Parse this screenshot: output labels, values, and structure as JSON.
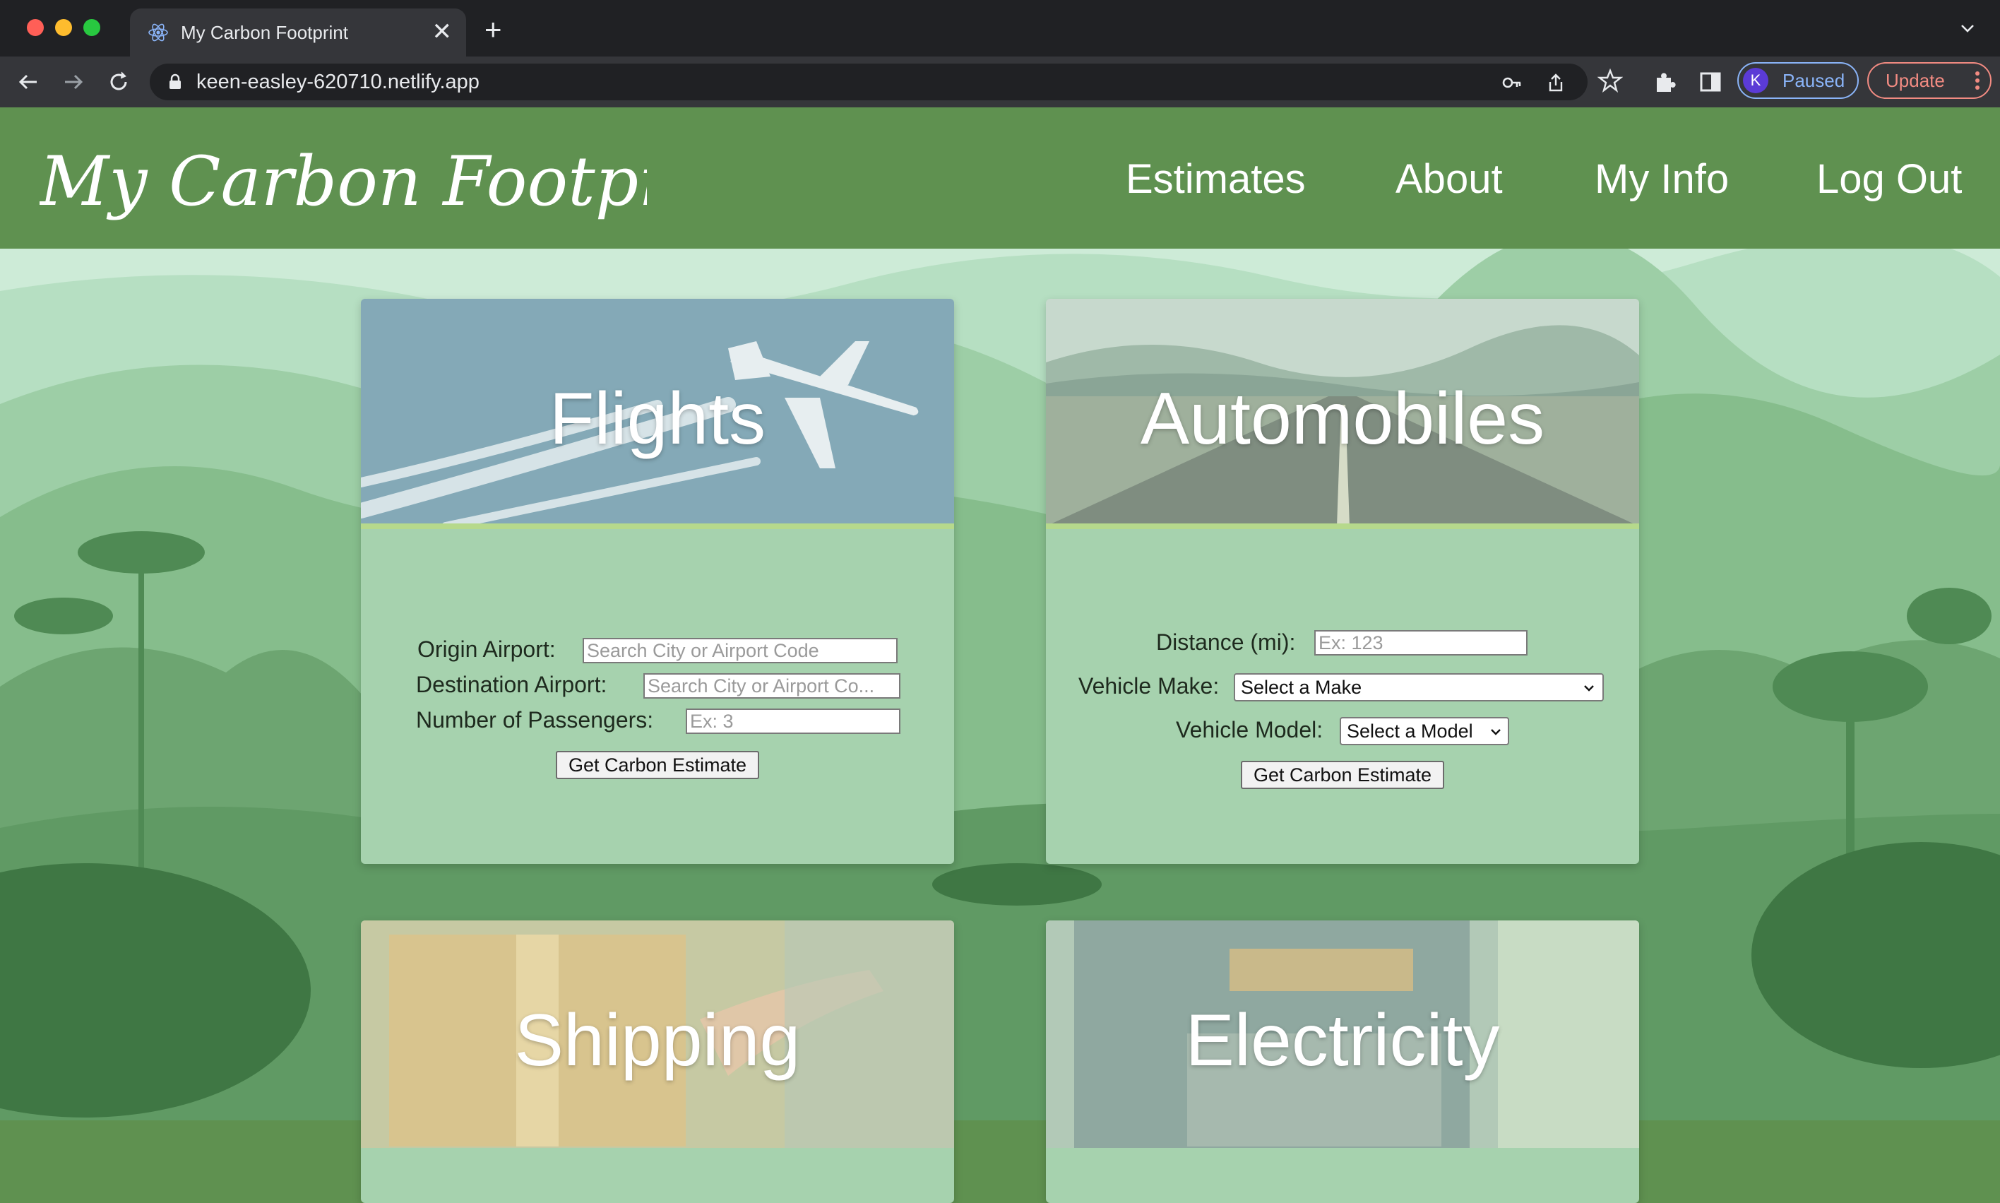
{
  "browser": {
    "tab_title": "My Carbon Footprint",
    "url": "keen-easley-620710.netlify.app",
    "profile_initial": "K",
    "profile_status": "Paused",
    "update_label": "Update"
  },
  "header": {
    "logo_text": "My Carbon Footprint",
    "nav": [
      "Estimates",
      "About",
      "My Info",
      "Log Out"
    ]
  },
  "flights": {
    "title": "Flights",
    "origin_label": "Origin Airport:",
    "origin_placeholder": "Search City or Airport Code",
    "destination_label": "Destination Airport:",
    "destination_placeholder": "Search City or Airport Co...",
    "passengers_label": "Number of Passengers:",
    "passengers_placeholder": "Ex: 3",
    "submit_label": "Get Carbon Estimate"
  },
  "automobiles": {
    "title": "Automobiles",
    "distance_label": "Distance (mi):",
    "distance_placeholder": "Ex: 123",
    "make_label": "Vehicle Make:",
    "make_value": "Select a Make",
    "model_label": "Vehicle Model:",
    "model_value": "Select a Model",
    "submit_label": "Get Carbon Estimate"
  },
  "shipping": {
    "title": "Shipping"
  },
  "electricity": {
    "title": "Electricity"
  },
  "colors": {
    "header_green": "#5f9150",
    "card_green": "#a6d2ae",
    "accent_stripe": "#b6d98c"
  }
}
